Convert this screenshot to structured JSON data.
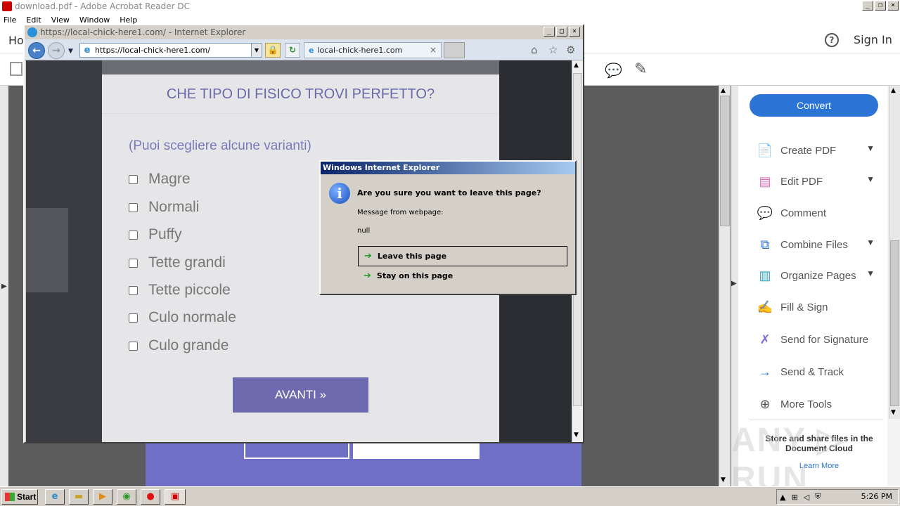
{
  "acrobat": {
    "title": "download.pdf - Adobe Acrobat Reader DC",
    "menu": [
      "File",
      "Edit",
      "View",
      "Window",
      "Help"
    ],
    "home_tab": "Ho",
    "sign_in": "Sign In",
    "help_glyph": "?",
    "convert_label": "Convert",
    "tools": [
      {
        "label": "Create PDF",
        "icon": "create-pdf-icon",
        "color": "#e34850",
        "expandable": true
      },
      {
        "label": "Edit PDF",
        "icon": "edit-pdf-icon",
        "color": "#e86ab5",
        "expandable": true
      },
      {
        "label": "Comment",
        "icon": "comment-icon",
        "color": "#f3b81f",
        "expandable": false
      },
      {
        "label": "Combine Files",
        "icon": "combine-files-icon",
        "color": "#2b74d6",
        "expandable": true
      },
      {
        "label": "Organize Pages",
        "icon": "organize-pages-icon",
        "color": "#2ba3c7",
        "expandable": true
      },
      {
        "label": "Fill & Sign",
        "icon": "fill-sign-icon",
        "color": "#7f6bd6",
        "expandable": false
      },
      {
        "label": "Send for Signature",
        "icon": "send-signature-icon",
        "color": "#7f6bd6",
        "expandable": false
      },
      {
        "label": "Send & Track",
        "icon": "send-track-icon",
        "color": "#2b74d6",
        "expandable": false
      },
      {
        "label": "More Tools",
        "icon": "more-tools-icon",
        "color": "#555555",
        "expandable": false
      }
    ],
    "cloud_text": "Store and share files in the Document Cloud",
    "learn_more": "Learn More",
    "accent_color": "#2b74d6"
  },
  "ie": {
    "title": "https://local-chick-here1.com/ - Internet Explorer",
    "address": "https://local-chick-here1.com/",
    "tab_label": "local-chick-here1.com"
  },
  "quiz": {
    "title": "CHE TIPO DI FISICO TROVI PERFETTO?",
    "subtitle": "(Puoi scegliere alcune varianti)",
    "options": [
      "Magre",
      "Normali",
      "Puffy",
      "Tette grandi",
      "Tette piccole",
      "Culo normale",
      "Culo grande"
    ],
    "next_label": "AVANTI »",
    "accent_color": "#6e6ab0"
  },
  "dialog": {
    "title": "Windows Internet Explorer",
    "question": "Are you sure you want to leave this page?",
    "message_label": "Message from webpage:",
    "message": "null",
    "leave_label": "Leave this page",
    "stay_label": "Stay on this page"
  },
  "taskbar": {
    "start_label": "Start",
    "clock": "5:26 PM"
  },
  "watermark": "ANY.RUN"
}
